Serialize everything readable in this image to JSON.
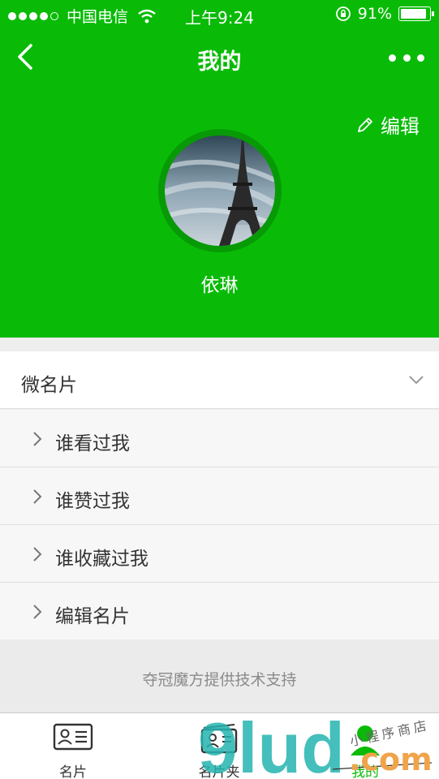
{
  "status_bar": {
    "carrier": "中国电信",
    "time": "上午9:24",
    "battery": "91%",
    "battery_level": 0.91
  },
  "nav": {
    "title": "我的",
    "back_icon": "chevron-left-icon",
    "more_icon": "more-dots-icon"
  },
  "profile": {
    "edit_label": "编辑",
    "name": "依琳",
    "avatar_icon": "eiffel-tower-photo"
  },
  "card_section": {
    "title": "微名片",
    "items": [
      {
        "label": "谁看过我"
      },
      {
        "label": "谁赞过我"
      },
      {
        "label": "谁收藏过我"
      },
      {
        "label": "编辑名片"
      }
    ]
  },
  "footer": {
    "note": "夺冠魔方提供技术支持"
  },
  "tabbar": {
    "tabs": [
      {
        "label": "名片",
        "icon": "id-card-icon"
      },
      {
        "label": "名片夹",
        "icon": "card-holder-icon"
      },
      {
        "label": "我的",
        "icon": "person-icon"
      }
    ]
  },
  "watermark": {
    "text": "小程序商店",
    "domain_a": "9lud",
    "domain_b": ".com"
  },
  "colors": {
    "accent": "#09bb07",
    "background": "#eeeeee"
  }
}
